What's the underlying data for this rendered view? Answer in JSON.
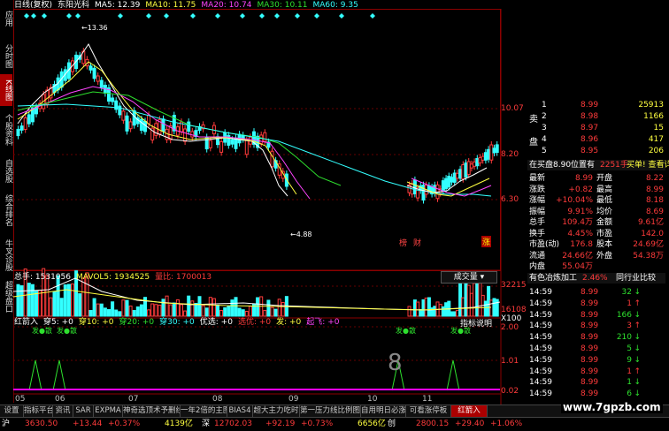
{
  "left_nav": [
    {
      "label": "应用",
      "active": false
    },
    {
      "label": "分时图",
      "active": false
    },
    {
      "label": "K线图",
      "active": true
    },
    {
      "label": "个股资料",
      "active": false
    },
    {
      "label": "自选股",
      "active": false
    },
    {
      "label": "综合排名",
      "active": false
    },
    {
      "label": "牛叉诊股",
      "active": false
    },
    {
      "label": "超级盘口",
      "active": false
    }
  ],
  "kline_header": {
    "period": "日线(复权)",
    "stock_name": "东阳光科",
    "ma5": "MA5: 12.39",
    "ma10": "MA10: 11.75",
    "ma20": "MA20: 10.74",
    "ma30": "MA30: 10.11",
    "ma60": "MA60: 9.35"
  },
  "kline_labels": {
    "high": "13.36",
    "low": "4.88",
    "marker_1": "榜",
    "marker_2": "财",
    "marker_3": "涨"
  },
  "kline_axis": [
    "10.07",
    "8.20",
    "6.30"
  ],
  "volume_header": {
    "total": "总手: 1531056",
    "mavol": "MAVOL5: 1934525",
    "ratio": "量比: 1700013",
    "dropdown": "成交量"
  },
  "volume_axis": [
    "32215",
    "16108",
    "X100"
  ],
  "indicator_header": {
    "name": "红箭入",
    "i1": "穿5: +0",
    "i2": "穿10: +0",
    "i3": "穿20: +0",
    "i4": "穿30: +0",
    "i5": "优选: +0",
    "i6": "选优: +0",
    "i7": "发: +0",
    "i8": "起飞: +0",
    "help": "指标说明"
  },
  "indicator_axis": [
    "2.00",
    "1.01",
    "0.02"
  ],
  "indicator_signals": [
    "发●散",
    "发●散",
    "发●散",
    "发●散"
  ],
  "watermark_digit": "8",
  "date_axis": [
    "05",
    "06",
    "07",
    "08",
    "09",
    "10",
    "11"
  ],
  "quote": {
    "sell_label": "卖",
    "buy_label": "盘",
    "asks": [
      {
        "n": "1",
        "price": "8.99",
        "vol": "25913"
      },
      {
        "n": "2",
        "price": "8.98",
        "vol": "1166"
      },
      {
        "n": "3",
        "price": "8.97",
        "vol": "15"
      },
      {
        "n": "4",
        "price": "8.96",
        "vol": "417"
      },
      {
        "n": "5",
        "price": "8.95",
        "vol": "206"
      }
    ],
    "notice_left": "在买盘8.90位置有",
    "notice_mid": "2251手",
    "notice_right": "买单! 查看详细",
    "stats": [
      {
        "k1": "最新",
        "v1": "8.99",
        "k2": "开盘",
        "v2": "8.22"
      },
      {
        "k1": "涨跌",
        "v1": "+0.82",
        "k2": "最高",
        "v2": "8.99"
      },
      {
        "k1": "涨幅",
        "v1": "+10.04%",
        "k2": "最低",
        "v2": "8.18"
      },
      {
        "k1": "振幅",
        "v1": "9.91%",
        "k2": "均价",
        "v2": "8.69"
      },
      {
        "k1": "总手",
        "v1": "109.4万",
        "k2": "金额",
        "v2": "9.61亿"
      },
      {
        "k1": "换手",
        "v1": "4.45%",
        "k2": "市盈",
        "v2": "142.0"
      },
      {
        "k1": "市盈(动)",
        "v1": "176.8",
        "k2": "股本",
        "v2": "24.69亿"
      },
      {
        "k1": "流通",
        "v1": "24.66亿",
        "k2": "外盘",
        "v2": "54.38万"
      },
      {
        "k1": "内盘",
        "v1": "55.04万",
        "k2": "",
        "v2": ""
      }
    ],
    "sector": "有色冶炼加工",
    "sector_pct": "2.46%",
    "compare": "同行业比较",
    "ticks": [
      {
        "t": "14:59",
        "p": "8.99",
        "v": "32",
        "dir": "down"
      },
      {
        "t": "14:59",
        "p": "8.99",
        "v": "1",
        "dir": "up"
      },
      {
        "t": "14:59",
        "p": "8.99",
        "v": "166",
        "dir": "down"
      },
      {
        "t": "14:59",
        "p": "8.99",
        "v": "3",
        "dir": "up"
      },
      {
        "t": "14:59",
        "p": "8.99",
        "v": "210",
        "dir": "down"
      },
      {
        "t": "14:59",
        "p": "8.99",
        "v": "5",
        "dir": "down"
      },
      {
        "t": "14:59",
        "p": "8.99",
        "v": "9",
        "dir": "down"
      },
      {
        "t": "14:59",
        "p": "8.99",
        "v": "1",
        "dir": "up"
      },
      {
        "t": "14:59",
        "p": "8.99",
        "v": "1",
        "dir": "down"
      },
      {
        "t": "14:59",
        "p": "8.99",
        "v": "6",
        "dir": "down"
      }
    ]
  },
  "tabs": [
    {
      "label": "设置",
      "active": false
    },
    {
      "label": "指标平台",
      "active": false
    },
    {
      "label": "资讯",
      "active": false
    },
    {
      "label": "SAR",
      "active": false
    },
    {
      "label": "EXPMA",
      "active": false
    },
    {
      "label": "神奇选顶术予删线",
      "active": false
    },
    {
      "label": "一年2倍的主图",
      "active": false
    },
    {
      "label": "BIAS4",
      "active": false
    },
    {
      "label": "超大主力吃时",
      "active": false
    },
    {
      "label": "第一压力线比例图",
      "active": false
    },
    {
      "label": "自用明日必涨",
      "active": false
    },
    {
      "label": "可看涨停板",
      "active": false
    },
    {
      "label": "红箭入",
      "active": true
    }
  ],
  "status_bar": {
    "hu": "沪",
    "sh_index": "3630.50",
    "sh_chg": "+13.44",
    "sh_pct": "+0.37%",
    "sh_amt": "4139亿",
    "shen": "深",
    "sz_index": "12702.03",
    "sz_chg": "+92.19",
    "sz_pct": "+0.73%",
    "sz_amt": "6656亿",
    "chuang": "创",
    "cy_index": "2800.15",
    "cy_chg": "+29.40",
    "cy_pct": "+1.06%",
    "watermark": "www.7gpzb.com"
  },
  "colors": {
    "up": "#ff3b3b",
    "down": "#2ee02e",
    "bg": "#000000",
    "grid": "#8b0000",
    "accent": "#ffff40"
  }
}
